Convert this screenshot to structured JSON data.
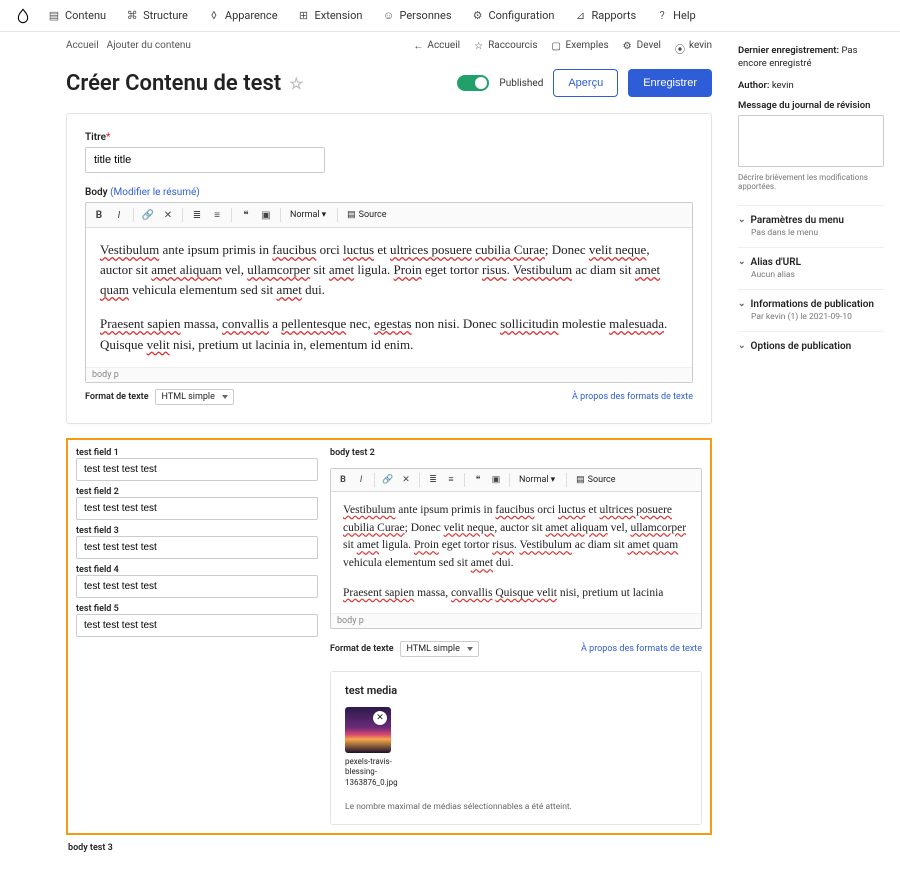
{
  "top_nav": {
    "items": [
      {
        "label": "Contenu"
      },
      {
        "label": "Structure"
      },
      {
        "label": "Apparence"
      },
      {
        "label": "Extension"
      },
      {
        "label": "Personnes"
      },
      {
        "label": "Configuration"
      },
      {
        "label": "Rapports"
      },
      {
        "label": "Help"
      }
    ]
  },
  "breadcrumbs": {
    "home": "Accueil",
    "current": "Ajouter du contenu"
  },
  "sub_actions": {
    "back": "Accueil",
    "shortcuts": "Raccourcis",
    "examples": "Exemples",
    "devel": "Devel",
    "user": "kevin"
  },
  "page_title": "Créer Contenu de test",
  "published_label": "Published",
  "btn_preview": "Aperçu",
  "btn_save": "Enregistrer",
  "form": {
    "title_label": "Titre",
    "title_value": "title title",
    "body_label": "Body",
    "edit_summary": "(Modifier le résumé)",
    "body_content_html": "Vestibulum ante ipsum primis in faucibus orci luctus et ultrices posuere cubilia Curae; Donec velit neque, auctor sit amet aliquam vel, ullamcorper sit amet ligula. Proin eget tortor risus. Vestibulum ac diam sit amet quam vehicula elementum sed sit amet dui.\n\nPraesent sapien massa, convallis a pellentesque nec, egestas non nisi. Donec sollicitudin molestie malesuada. Quisque velit nisi, pretium ut lacinia in, elementum id enim.",
    "editor_path": "body   p",
    "format_label": "Format de texte",
    "format_value": "HTML simple",
    "about_formats": "À propos des formats de texte",
    "toolbar_style_normal": "Normal",
    "toolbar_source": "Source"
  },
  "highlighted": {
    "fields": [
      {
        "label": "test field 1",
        "value": "test test test test"
      },
      {
        "label": "test field 2",
        "value": "test test test test"
      },
      {
        "label": "test field 3",
        "value": "test test test test"
      },
      {
        "label": "test field 4",
        "value": "test test test test"
      },
      {
        "label": "test field 5",
        "value": "test test test test"
      }
    ],
    "body2_label": "body test 2",
    "body2_content": "Vestibulum ante ipsum primis in faucibus orci luctus et ultrices posuere cubilia Curae; Donec velit neque, auctor sit amet aliquam vel, ullamcorper sit amet ligula. Proin eget tortor risus. Vestibulum ac diam sit amet quam vehicula elementum sed sit amet dui.\n\nPraesent sapien massa, convallis Quisque velit nisi, pretium ut lacinia",
    "media_label": "test media",
    "media_filename": "pexels-travis-blessing-1363876_0.jpg",
    "media_note": "Le nombre maximal de médias sélectionnables a été atteint.",
    "below_label": "body test 3"
  },
  "sidebar": {
    "last_save_label": "Dernier enregistrement:",
    "last_save_value": "Pas encore enregistré",
    "author_label": "Author:",
    "author_value": "kevin",
    "revlog_label": "Message du journal de révision",
    "revlog_hint": "Décrire brièvement les modifications apportées.",
    "accordions": [
      {
        "title": "Paramètres du menu",
        "sub": "Pas dans le menu"
      },
      {
        "title": "Alias d'URL",
        "sub": "Aucun alias"
      },
      {
        "title": "Informations de publication",
        "sub": "Par kevin (1) le 2021-09-10"
      },
      {
        "title": "Options de publication",
        "sub": ""
      }
    ]
  }
}
